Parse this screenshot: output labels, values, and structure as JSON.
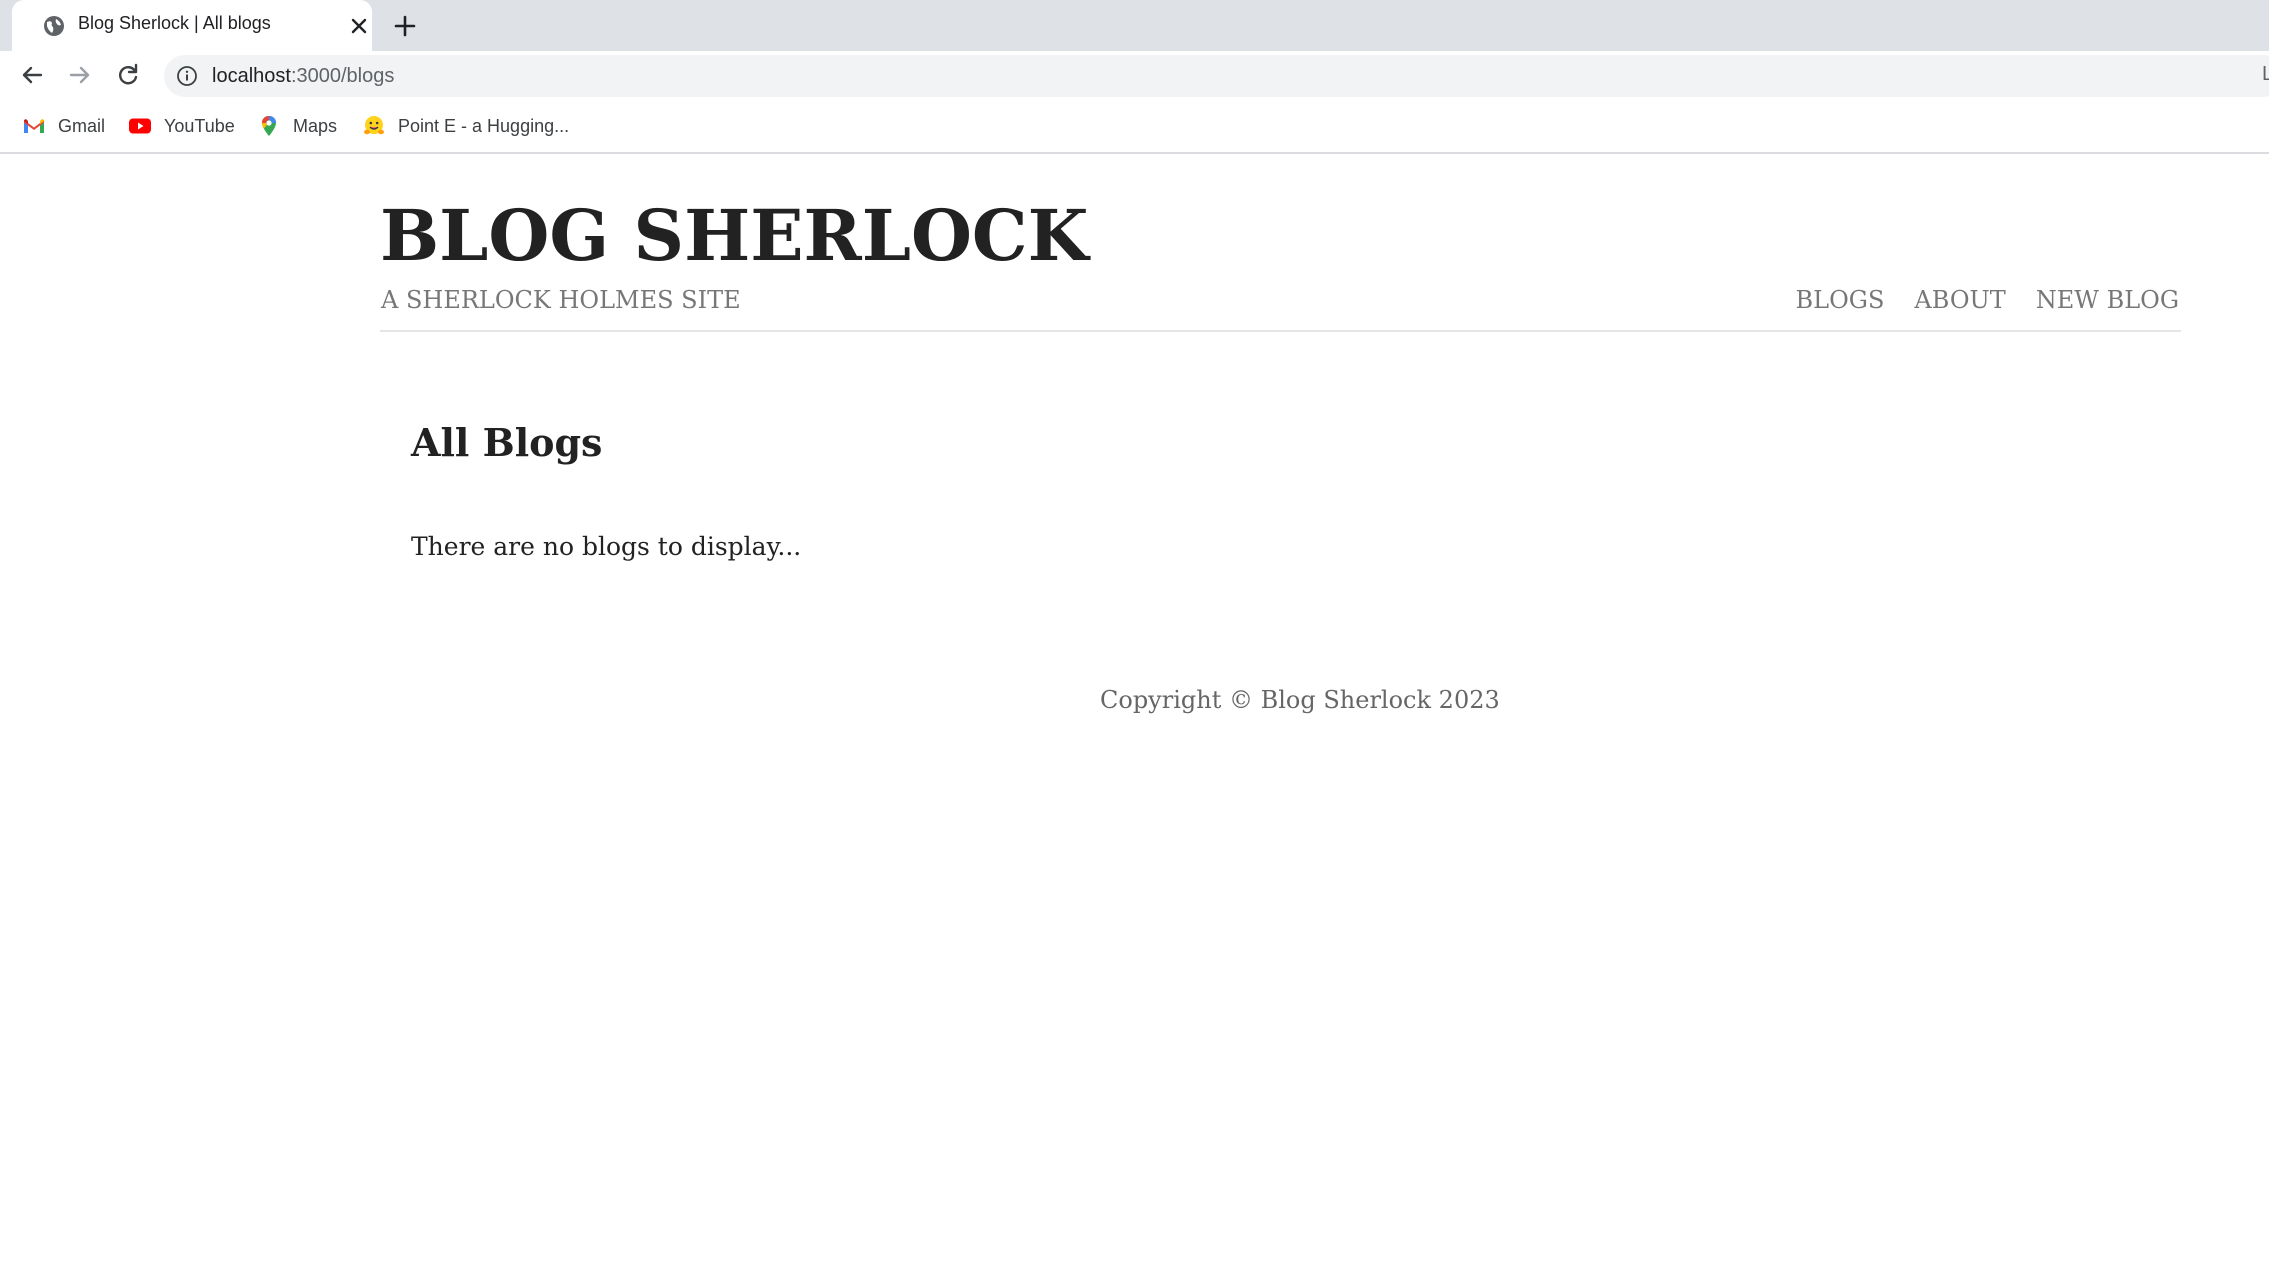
{
  "browser": {
    "tab": {
      "title": "Blog Sherlock | All blogs",
      "favicon": "globe-icon"
    },
    "address": {
      "host": "localhost",
      "path": ":3000/blogs"
    },
    "toolbar_edge_text": "L",
    "bookmarks": [
      {
        "label": "Gmail",
        "icon": "gmail-icon"
      },
      {
        "label": "YouTube",
        "icon": "youtube-icon"
      },
      {
        "label": "Maps",
        "icon": "maps-icon"
      },
      {
        "label": "Point E - a Hugging...",
        "icon": "hugging-face-icon"
      }
    ]
  },
  "site": {
    "title": "BLOG SHERLOCK",
    "tagline": "A SHERLOCK HOLMES SITE",
    "nav": {
      "blogs": "BLOGS",
      "about": "ABOUT",
      "new_blog": "NEW BLOG"
    }
  },
  "main": {
    "heading": "All Blogs",
    "empty_message": "There are no blogs to display..."
  },
  "footer": {
    "text": "Copyright © Blog Sherlock 2023"
  },
  "colors": {
    "tabstrip": "#dee1e6",
    "omnibox": "#f1f3f4",
    "title_text": "#222222",
    "muted_text": "#777777"
  }
}
